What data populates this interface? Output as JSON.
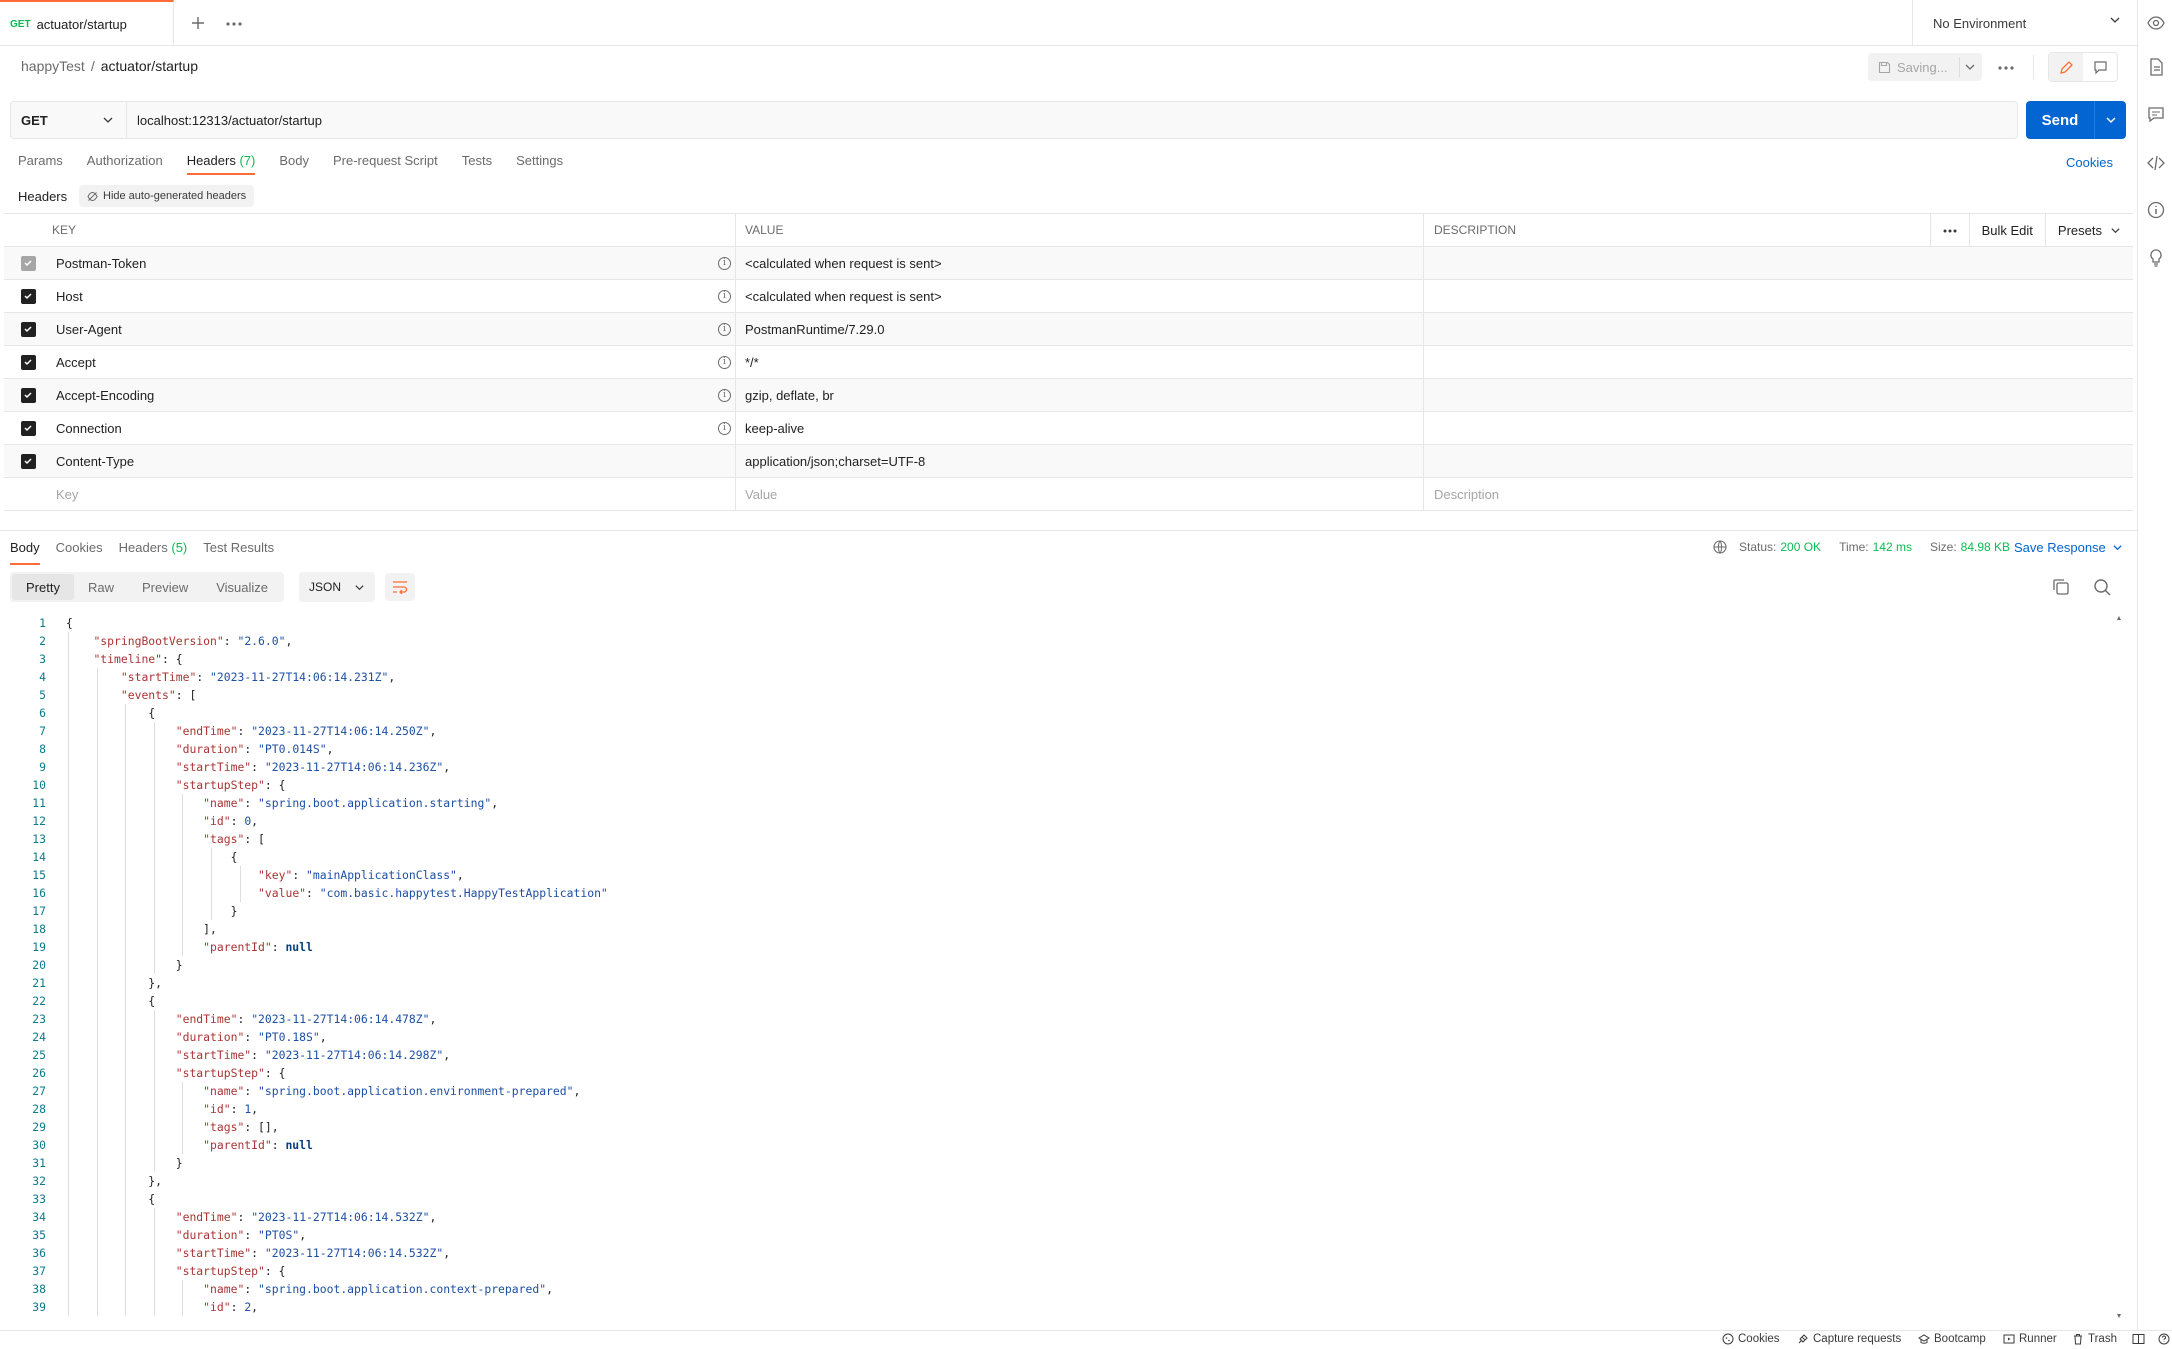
{
  "tab": {
    "method": "GET",
    "name": "actuator/startup"
  },
  "environment": {
    "selected": "No Environment"
  },
  "breadcrumb": {
    "collection": "happyTest",
    "separator": "/",
    "request": "actuator/startup"
  },
  "toolbar": {
    "saving_label": "Saving..."
  },
  "request": {
    "method": "GET",
    "url": "localhost:12313/actuator/startup",
    "send_label": "Send"
  },
  "request_tabs": [
    {
      "label": "Params"
    },
    {
      "label": "Authorization"
    },
    {
      "label": "Headers",
      "count": "(7)"
    },
    {
      "label": "Body"
    },
    {
      "label": "Pre-request Script"
    },
    {
      "label": "Tests"
    },
    {
      "label": "Settings"
    }
  ],
  "cookies_link": "Cookies",
  "headers_section": {
    "label": "Headers",
    "hide_auto_label": "Hide auto-generated headers"
  },
  "headers_table": {
    "columns": {
      "key": "KEY",
      "value": "VALUE",
      "description": "DESCRIPTION"
    },
    "bulk_edit": "Bulk Edit",
    "presets": "Presets",
    "rows": [
      {
        "key": "Postman-Token",
        "value": "<calculated when request is sent>"
      },
      {
        "key": "Host",
        "value": "<calculated when request is sent>"
      },
      {
        "key": "User-Agent",
        "value": "PostmanRuntime/7.29.0"
      },
      {
        "key": "Accept",
        "value": "*/*"
      },
      {
        "key": "Accept-Encoding",
        "value": "gzip, deflate, br"
      },
      {
        "key": "Connection",
        "value": "keep-alive"
      },
      {
        "key": "Content-Type",
        "value": "application/json;charset=UTF-8"
      }
    ],
    "placeholders": {
      "key": "Key",
      "value": "Value",
      "description": "Description"
    }
  },
  "response_tabs": [
    {
      "label": "Body"
    },
    {
      "label": "Cookies"
    },
    {
      "label": "Headers",
      "count": "(5)"
    },
    {
      "label": "Test Results"
    }
  ],
  "response_status": {
    "status_label": "Status:",
    "status": "200 OK",
    "time_label": "Time:",
    "time": "142 ms",
    "size_label": "Size:",
    "size": "84.98 KB",
    "save_label": "Save Response"
  },
  "view_modes": [
    "Pretty",
    "Raw",
    "Preview",
    "Visualize"
  ],
  "language": "JSON",
  "code_lines": [
    "{",
    "    \"springBootVersion\": \"2.6.0\",",
    "    \"timeline\": {",
    "        \"startTime\": \"2023-11-27T14:06:14.231Z\",",
    "        \"events\": [",
    "            {",
    "                \"endTime\": \"2023-11-27T14:06:14.250Z\",",
    "                \"duration\": \"PT0.014S\",",
    "                \"startTime\": \"2023-11-27T14:06:14.236Z\",",
    "                \"startupStep\": {",
    "                    \"name\": \"spring.boot.application.starting\",",
    "                    \"id\": 0,",
    "                    \"tags\": [",
    "                        {",
    "                            \"key\": \"mainApplicationClass\",",
    "                            \"value\": \"com.basic.happytest.HappyTestApplication\"",
    "                        }",
    "                    ],",
    "                    \"parentId\": null",
    "                }",
    "            },",
    "            {",
    "                \"endTime\": \"2023-11-27T14:06:14.478Z\",",
    "                \"duration\": \"PT0.18S\",",
    "                \"startTime\": \"2023-11-27T14:06:14.298Z\",",
    "                \"startupStep\": {",
    "                    \"name\": \"spring.boot.application.environment-prepared\",",
    "                    \"id\": 1,",
    "                    \"tags\": [],",
    "                    \"parentId\": null",
    "                }",
    "            },",
    "            {",
    "                \"endTime\": \"2023-11-27T14:06:14.532Z\",",
    "                \"duration\": \"PT0S\",",
    "                \"startTime\": \"2023-11-27T14:06:14.532Z\",",
    "                \"startupStep\": {",
    "                    \"name\": \"spring.boot.application.context-prepared\",",
    "                    \"id\": 2,"
  ],
  "status_bar": [
    "Cookies",
    "Capture requests",
    "Bootcamp",
    "Runner",
    "Trash"
  ],
  "icons": {
    "right_bar": [
      "eye-icon",
      "document-icon",
      "comment-icon",
      "code-icon",
      "info-icon",
      "lightbulb-icon"
    ]
  },
  "colors": {
    "accent": "#ff6c37",
    "primary": "#0265d2",
    "success": "#0cbb52"
  }
}
